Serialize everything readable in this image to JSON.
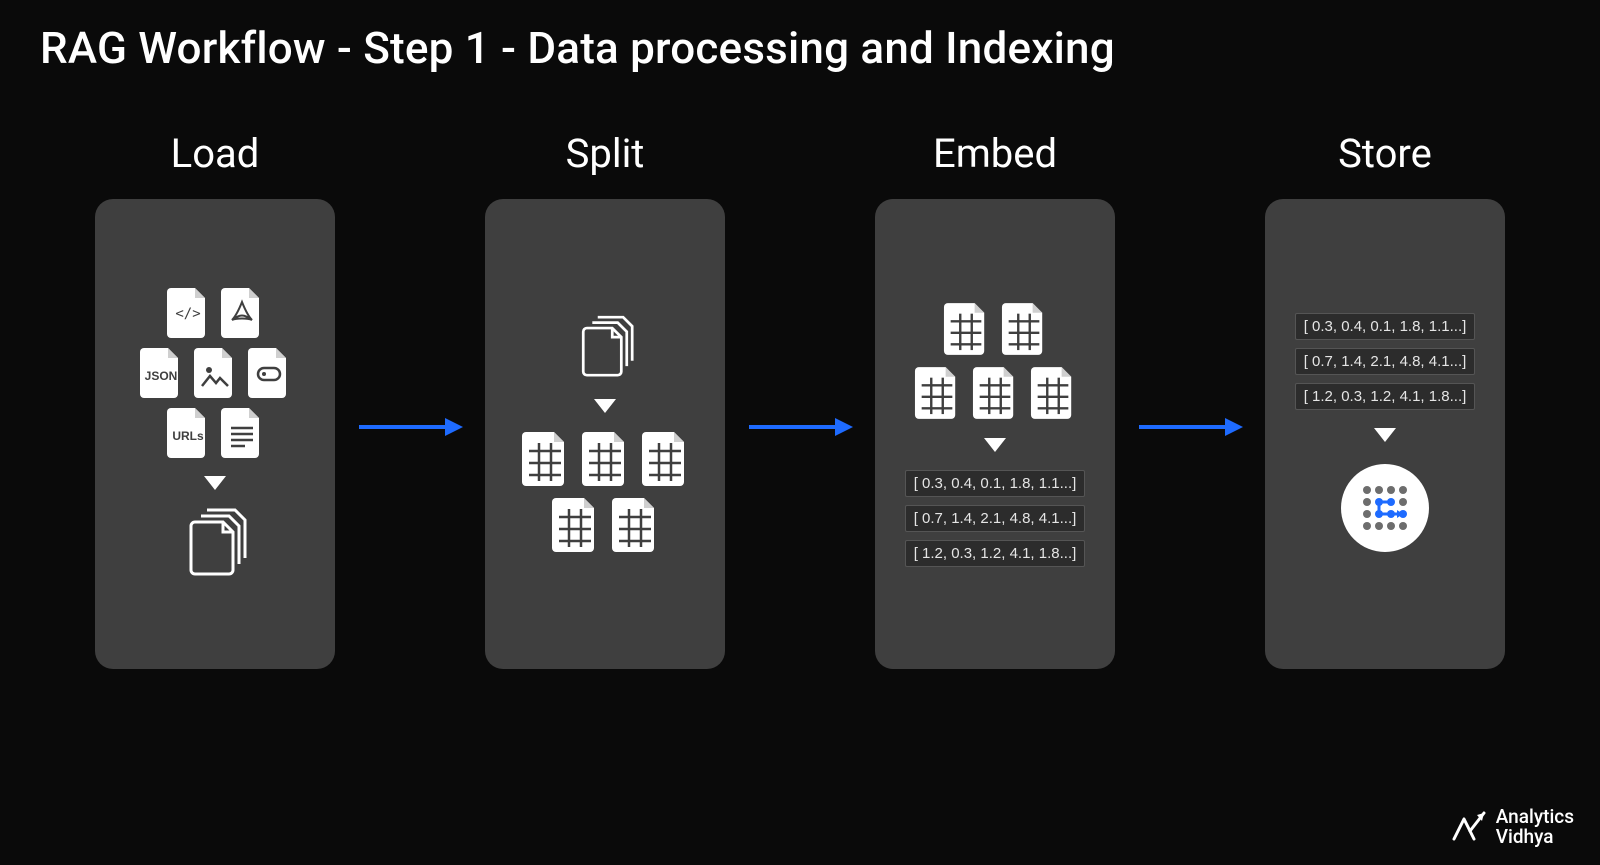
{
  "title": "RAG Workflow - Step 1 - Data processing and Indexing",
  "stages": {
    "load": {
      "label": "Load"
    },
    "split": {
      "label": "Split"
    },
    "embed": {
      "label": "Embed"
    },
    "store": {
      "label": "Store"
    }
  },
  "file_types": {
    "code": "</>",
    "pdf": "PDF",
    "json": "JSON",
    "image": "image",
    "db": "db",
    "urls": "URLs",
    "text": "text"
  },
  "vectors": {
    "v1": "[ 0.3, 0.4, 0.1, 1.8, 1.1...]",
    "v2": "[ 0.7, 1.4, 2.1, 4.8, 4.1...]",
    "v3": "[ 1.2, 0.3, 1.2, 4.1, 1.8...]"
  },
  "brand": {
    "line1": "Analytics",
    "line2": "Vidhya"
  }
}
